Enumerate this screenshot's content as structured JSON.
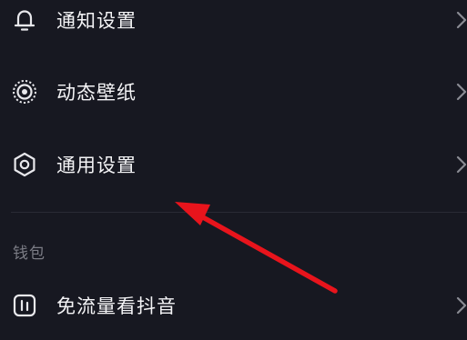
{
  "settings": {
    "items": [
      {
        "label": "通知设置",
        "icon": "bell-icon"
      },
      {
        "label": "动态壁纸",
        "icon": "live-wallpaper-icon"
      },
      {
        "label": "通用设置",
        "icon": "gear-icon"
      }
    ]
  },
  "wallet": {
    "title": "钱包",
    "items": [
      {
        "label": "免流量看抖音",
        "icon": "data-free-icon"
      }
    ]
  },
  "colors": {
    "background": "#171821",
    "text": "#f4f4f6",
    "section_title": "#7b7c85",
    "annotation_arrow": "#e8141c"
  }
}
